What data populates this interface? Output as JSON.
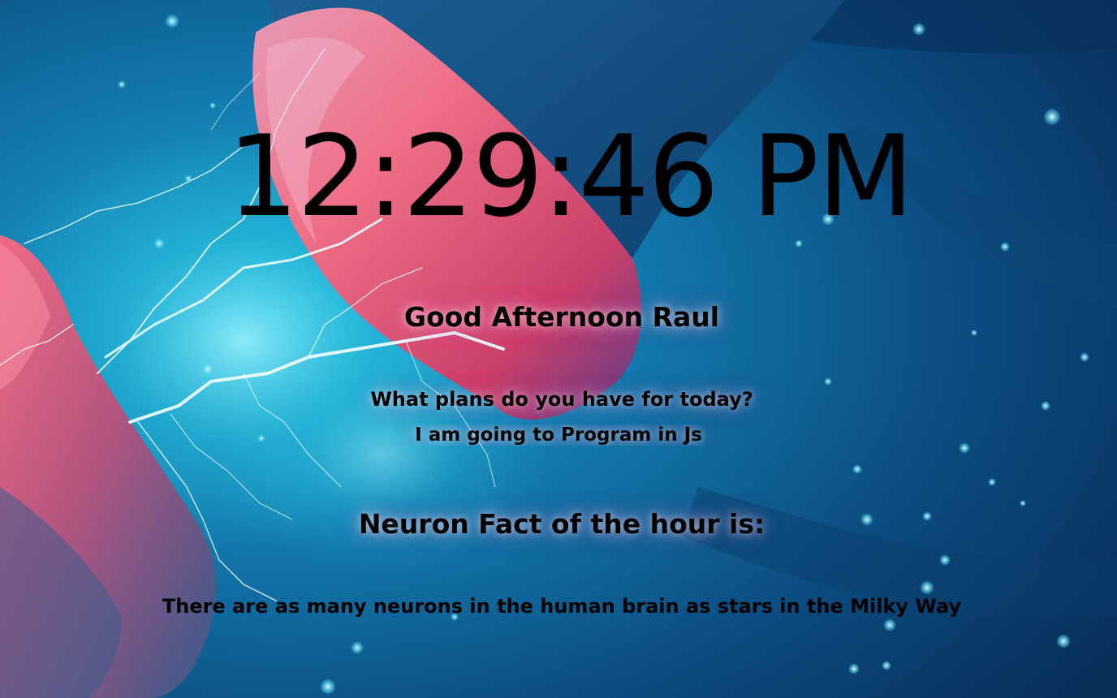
{
  "clock": {
    "time": "12:29:46 PM"
  },
  "greeting": {
    "text": "Good Afternoon Raul"
  },
  "focus": {
    "question": "What plans do you have for today?",
    "answer": "I am going to Program in Js"
  },
  "fact": {
    "title": "Neuron Fact of the hour is:",
    "text": "There are as many neurons in the human brain as stars in the Milky Way"
  },
  "background": {
    "subject": "neurons with electric sparks",
    "colors": {
      "deep_blue": "#0a3a66",
      "cyan": "#1fb2d6",
      "neuron_pink": "#e86a8a",
      "spark_white": "#e8fbff"
    }
  }
}
